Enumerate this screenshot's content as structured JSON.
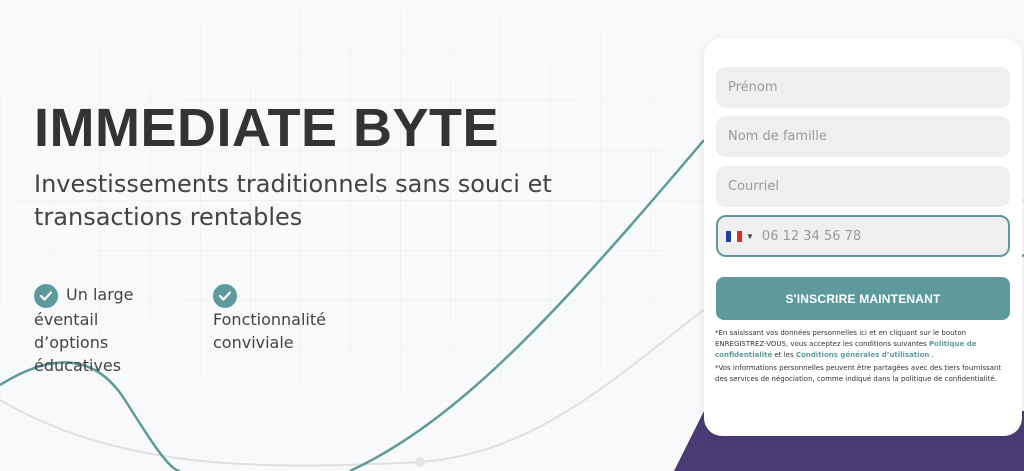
{
  "hero": {
    "title": "IMMEDIATE BYTE",
    "subtitle": "Investissements traditionnels sans souci et transactions rentables"
  },
  "features": [
    {
      "label": "Un large éventail d’options éducatives",
      "icon": "check-icon"
    },
    {
      "label": "Fonctionnalité conviviale",
      "icon": "check-icon"
    }
  ],
  "form": {
    "first_name_placeholder": "Prénom",
    "last_name_placeholder": "Nom de famille",
    "email_placeholder": "Courriel",
    "phone_placeholder": "06 12 34 56 78",
    "country_flag": "flag-fr-icon",
    "submit_label": "S'INSCRIRE MAINTENANT",
    "legal1_prefix": "*En saisissant vos données personnelles ici et en cliquant sur le bouton ENREGISTREZ-VOUS, vous acceptez les conditions suivantes ",
    "privacy_link": "Politique de confidentialité",
    "legal1_mid": " et les ",
    "terms_link": "Conditions générales d’utilisation",
    "legal1_suffix": " .",
    "legal2": "*Vos informations personnelles peuvent être partagées avec des tiers fournissant des services de négociation, comme indiqué dans la politique de confidentialité."
  },
  "colors": {
    "accent": "#5e9a9c",
    "purple": "#4a3b75",
    "field_bg": "#efefef",
    "background": "#f7f9fb"
  }
}
